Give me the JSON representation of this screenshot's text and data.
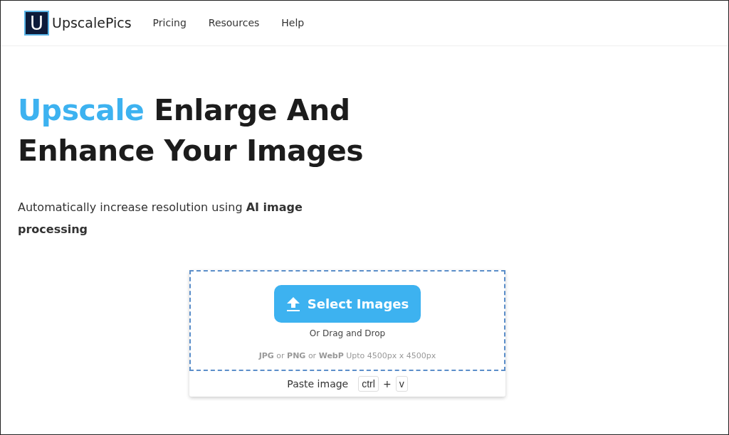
{
  "header": {
    "logo_letter": "U",
    "brand": "UpscalePics",
    "nav": [
      "Pricing",
      "Resources",
      "Help"
    ]
  },
  "hero": {
    "title_highlight": "Upscale",
    "title_rest": "Enlarge And Enhance Your Images",
    "subtitle": "Automatically increase resolution using **AI image processing**"
  },
  "uploader": {
    "button": "Select Images",
    "drag_text": "Or Drag and Drop",
    "formats": "**JPG** or **PNG** or **WebP** Upto 4500px x 4500px",
    "paste_label": "Paste image",
    "keys": [
      "ctrl",
      "v"
    ],
    "key_joiner": "+"
  }
}
